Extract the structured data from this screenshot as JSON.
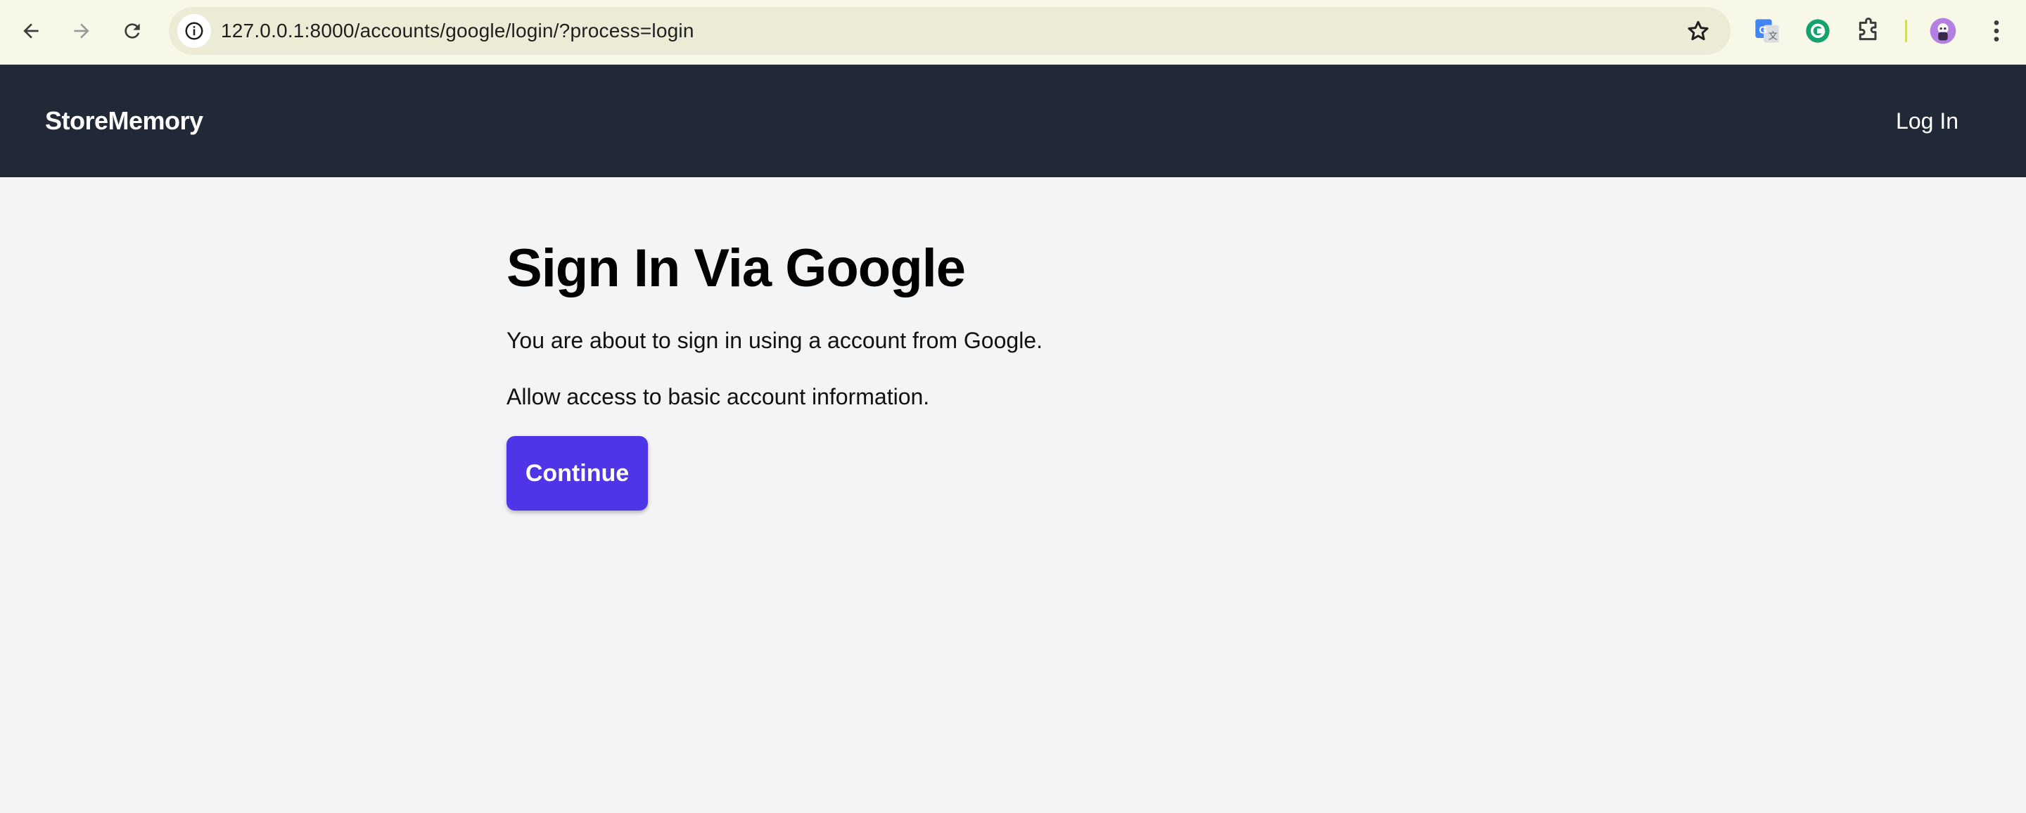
{
  "browser": {
    "url": "127.0.0.1:8000/accounts/google/login/?process=login",
    "icons": {
      "back": "arrow-left-icon",
      "forward": "arrow-right-icon",
      "reload": "reload-icon",
      "site_info": "info-icon",
      "bookmark": "star-icon",
      "translate": "google-translate-icon",
      "grammarly": "grammarly-icon",
      "extensions": "puzzle-icon",
      "profile": "avatar-icon",
      "menu": "kebab-menu-icon"
    }
  },
  "header": {
    "brand": "StoreMemory",
    "login_link": "Log In",
    "background_color": "#222936"
  },
  "main": {
    "title": "Sign In Via Google",
    "description": "You are about to sign in using a account from Google.",
    "permission": "Allow access to basic account information.",
    "continue_button": "Continue",
    "button_color": "#4f35e8"
  }
}
